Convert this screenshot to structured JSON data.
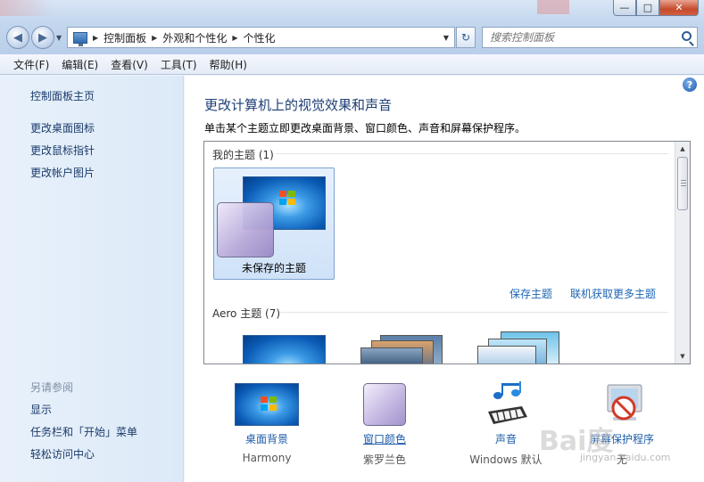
{
  "window": {
    "caption_buttons": {
      "minimize": "—",
      "maximize": "□",
      "close": "✕"
    }
  },
  "nav": {
    "back_glyph": "◀",
    "forward_glyph": "▶",
    "breadcrumbs": [
      "控制面板",
      "外观和个性化",
      "个性化"
    ],
    "search_placeholder": "搜索控制面板",
    "refresh_glyph": "↻"
  },
  "menu": [
    "文件(F)",
    "编辑(E)",
    "查看(V)",
    "工具(T)",
    "帮助(H)"
  ],
  "sidebar": {
    "home": "控制面板主页",
    "links": [
      "更改桌面图标",
      "更改鼠标指针",
      "更改帐户图片"
    ],
    "see_also_title": "另请参阅",
    "see_also": [
      "显示",
      "任务栏和「开始」菜单",
      "轻松访问中心"
    ]
  },
  "main": {
    "help_glyph": "?",
    "heading": "更改计算机上的视觉效果和声音",
    "description": "单击某个主题立即更改桌面背景、窗口颜色、声音和屏幕保护程序。",
    "my_themes_label": "我的主题 (1)",
    "unsaved_theme": "未保存的主题",
    "save_theme": "保存主题",
    "get_more_themes": "联机获取更多主题",
    "aero_label": "Aero 主题 (7)"
  },
  "settings": [
    {
      "label": "桌面背景",
      "value": "Harmony",
      "icon": "desktop-background-icon"
    },
    {
      "label": "窗口颜色",
      "value": "紫罗兰色",
      "icon": "window-color-icon"
    },
    {
      "label": "声音",
      "value": "Windows 默认",
      "icon": "sounds-icon"
    },
    {
      "label": "屏幕保护程序",
      "value": "无",
      "icon": "screen-saver-icon"
    }
  ],
  "watermark": {
    "logo": "Bai度",
    "url": "jingyan.baidu.com"
  },
  "colors": {
    "link": "#1d66b4",
    "heading": "#1e3f75",
    "accent_purple": "#b8a8d8"
  }
}
